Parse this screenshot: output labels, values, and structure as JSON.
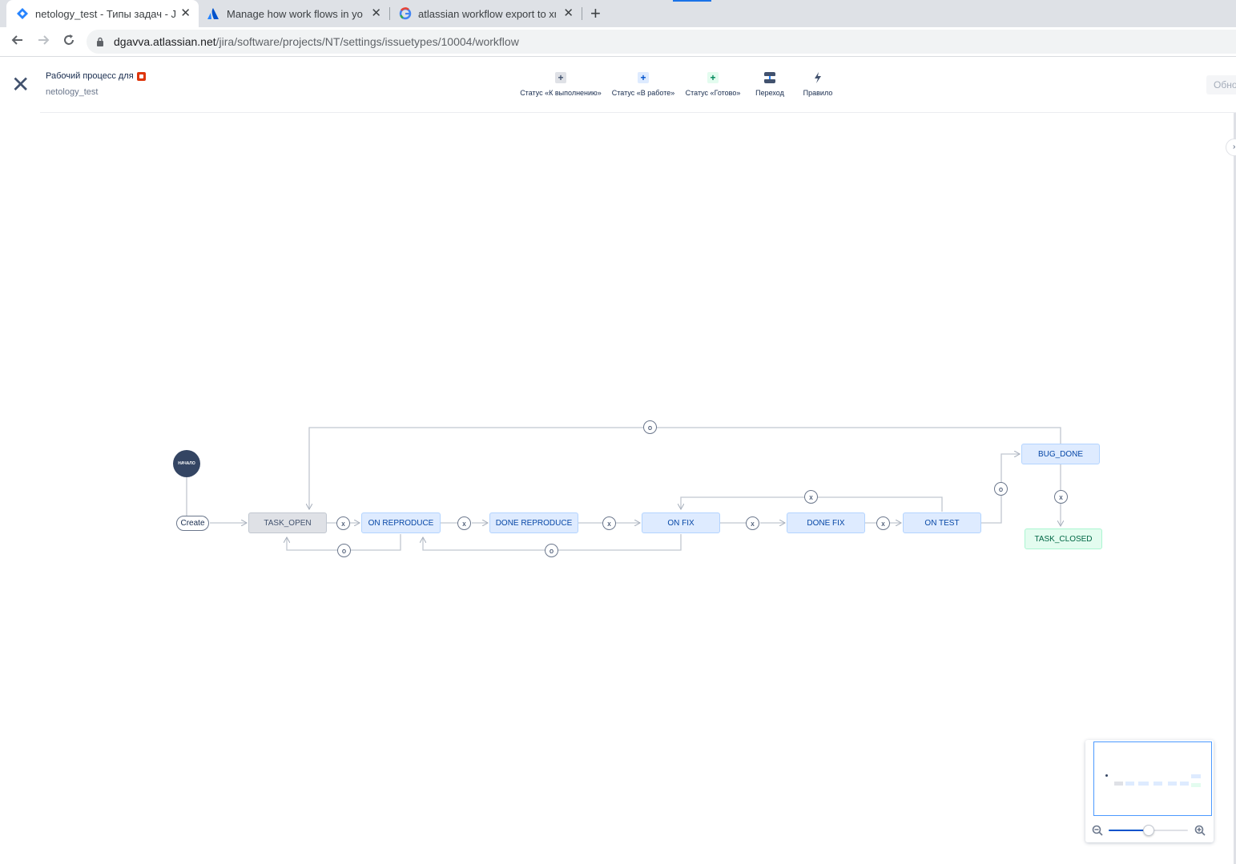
{
  "browser": {
    "tabs": [
      {
        "title": "netology_test - Типы задач - Jira",
        "icon": "jira-icon",
        "active": true
      },
      {
        "title": "Manage how work flows in your",
        "icon": "atlassian-icon",
        "active": false
      },
      {
        "title": "atlassian workflow export to xml",
        "icon": "google-icon",
        "active": false
      }
    ],
    "url_domain": "dgavva.atlassian.net",
    "url_path": "/jira/software/projects/NT/settings/issuetypes/10004/workflow"
  },
  "header": {
    "title": "Рабочий процесс для",
    "subtitle": "netology_test",
    "update_label": "Обно"
  },
  "toolbar": {
    "items": [
      {
        "label": "Статус «К выполнению»",
        "icon": "plus-icon"
      },
      {
        "label": "Статус «В работе»",
        "icon": "plus-icon"
      },
      {
        "label": "Статус «Готово»",
        "icon": "plus-icon"
      },
      {
        "label": "Переход",
        "icon": "transition-icon"
      },
      {
        "label": "Правило",
        "icon": "bolt-icon"
      }
    ]
  },
  "diagram": {
    "start_label": "НАЧАЛО",
    "create_label": "Create",
    "statuses": [
      {
        "name": "TASK_OPEN",
        "category": "todo"
      },
      {
        "name": "ON REPRODUCE",
        "category": "in-progress"
      },
      {
        "name": "DONE REPRODUCE",
        "category": "in-progress"
      },
      {
        "name": "ON FIX",
        "category": "in-progress"
      },
      {
        "name": "DONE FIX",
        "category": "in-progress"
      },
      {
        "name": "ON TEST",
        "category": "in-progress"
      },
      {
        "name": "BUG_DONE",
        "category": "in-progress"
      },
      {
        "name": "TASK_CLOSED",
        "category": "done"
      }
    ],
    "transitions": [
      "o",
      "x",
      "x",
      "x",
      "x",
      "x",
      "x",
      "o",
      "o",
      "o",
      "x"
    ]
  },
  "colors": {
    "todo": "#dfe1e6",
    "in_progress": "#deebff",
    "done": "#e3fcef",
    "line": "#c1c7d0",
    "accent": "#0052cc"
  },
  "minimap": {
    "zoom_fraction": 0.5
  }
}
